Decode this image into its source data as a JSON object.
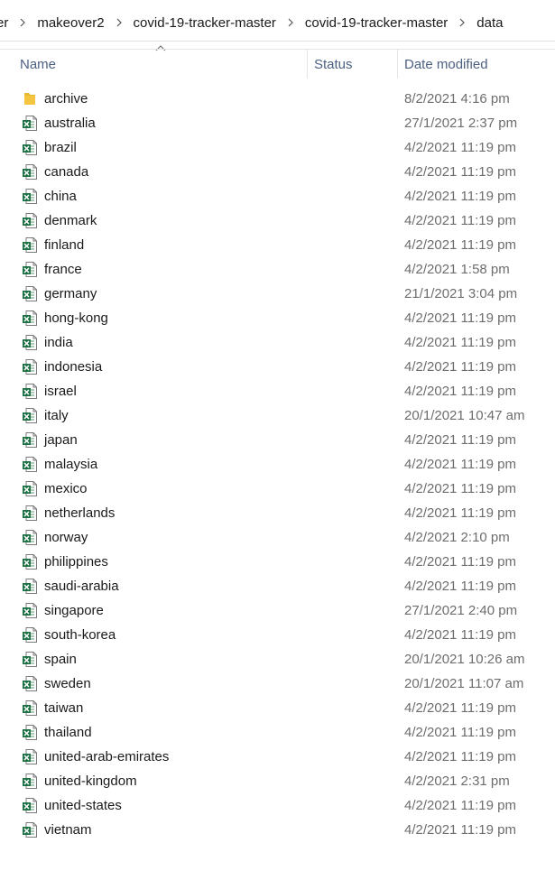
{
  "breadcrumb": [
    "er",
    "makeover2",
    "covid-19-tracker-master",
    "covid-19-tracker-master",
    "data"
  ],
  "columns": {
    "name": "Name",
    "status": "Status",
    "date_modified": "Date modified"
  },
  "files": [
    {
      "name": "archive",
      "type": "folder",
      "date": "8/2/2021 4:16 pm"
    },
    {
      "name": "australia",
      "type": "excel",
      "date": "27/1/2021 2:37 pm"
    },
    {
      "name": "brazil",
      "type": "excel",
      "date": "4/2/2021 11:19 pm"
    },
    {
      "name": "canada",
      "type": "excel",
      "date": "4/2/2021 11:19 pm"
    },
    {
      "name": "china",
      "type": "excel",
      "date": "4/2/2021 11:19 pm"
    },
    {
      "name": "denmark",
      "type": "excel",
      "date": "4/2/2021 11:19 pm"
    },
    {
      "name": "finland",
      "type": "excel",
      "date": "4/2/2021 11:19 pm"
    },
    {
      "name": "france",
      "type": "excel",
      "date": "4/2/2021 1:58 pm"
    },
    {
      "name": "germany",
      "type": "excel",
      "date": "21/1/2021 3:04 pm"
    },
    {
      "name": "hong-kong",
      "type": "excel",
      "date": "4/2/2021 11:19 pm"
    },
    {
      "name": "india",
      "type": "excel",
      "date": "4/2/2021 11:19 pm"
    },
    {
      "name": "indonesia",
      "type": "excel",
      "date": "4/2/2021 11:19 pm"
    },
    {
      "name": "israel",
      "type": "excel",
      "date": "4/2/2021 11:19 pm"
    },
    {
      "name": "italy",
      "type": "excel",
      "date": "20/1/2021 10:47 am"
    },
    {
      "name": "japan",
      "type": "excel",
      "date": "4/2/2021 11:19 pm"
    },
    {
      "name": "malaysia",
      "type": "excel",
      "date": "4/2/2021 11:19 pm"
    },
    {
      "name": "mexico",
      "type": "excel",
      "date": "4/2/2021 11:19 pm"
    },
    {
      "name": "netherlands",
      "type": "excel",
      "date": "4/2/2021 11:19 pm"
    },
    {
      "name": "norway",
      "type": "excel",
      "date": "4/2/2021 2:10 pm"
    },
    {
      "name": "philippines",
      "type": "excel",
      "date": "4/2/2021 11:19 pm"
    },
    {
      "name": "saudi-arabia",
      "type": "excel",
      "date": "4/2/2021 11:19 pm"
    },
    {
      "name": "singapore",
      "type": "excel",
      "date": "27/1/2021 2:40 pm"
    },
    {
      "name": "south-korea",
      "type": "excel",
      "date": "4/2/2021 11:19 pm"
    },
    {
      "name": "spain",
      "type": "excel",
      "date": "20/1/2021 10:26 am"
    },
    {
      "name": "sweden",
      "type": "excel",
      "date": "20/1/2021 11:07 am"
    },
    {
      "name": "taiwan",
      "type": "excel",
      "date": "4/2/2021 11:19 pm"
    },
    {
      "name": "thailand",
      "type": "excel",
      "date": "4/2/2021 11:19 pm"
    },
    {
      "name": "united-arab-emirates",
      "type": "excel",
      "date": "4/2/2021 11:19 pm"
    },
    {
      "name": "united-kingdom",
      "type": "excel",
      "date": "4/2/2021 2:31 pm"
    },
    {
      "name": "united-states",
      "type": "excel",
      "date": "4/2/2021 11:19 pm"
    },
    {
      "name": "vietnam",
      "type": "excel",
      "date": "4/2/2021 11:19 pm"
    }
  ],
  "colors": {
    "header_text": "#4d6082",
    "date_text": "#6d6d6d",
    "excel_green": "#1e7145",
    "folder_yellow": "#f5c542"
  }
}
